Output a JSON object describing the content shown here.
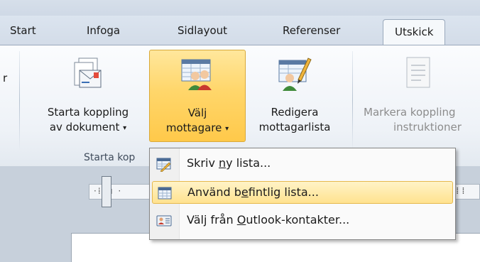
{
  "tabs": [
    {
      "label": "Start"
    },
    {
      "label": "Infoga"
    },
    {
      "label": "Sidlayout"
    },
    {
      "label": "Referenser"
    },
    {
      "label": "Utskick"
    }
  ],
  "ribbon": {
    "cutoff_left_label": "r",
    "buttons": [
      {
        "line1": "Starta koppling",
        "line2": "av dokument",
        "icon": "start-merge-icon"
      },
      {
        "line1": "Välj",
        "line2": "mottagare",
        "icon": "select-recipients-icon"
      },
      {
        "line1": "Redigera",
        "line2": "mottagarlista",
        "icon": "edit-recipient-list-icon"
      },
      {
        "line1": "Markera koppling",
        "line2": "instruktioner",
        "icon": "highlight-merge-fields-icon"
      }
    ],
    "group_label": "Starta kop"
  },
  "menu": {
    "items": [
      {
        "pre": "Skriv ",
        "key": "n",
        "post": "y lista...",
        "icon": "type-new-list-icon"
      },
      {
        "pre": "Använd b",
        "key": "e",
        "post": "fintlig lista...",
        "icon": "existing-list-icon"
      },
      {
        "pre": "Välj från ",
        "key": "O",
        "post": "utlook-kontakter...",
        "icon": "outlook-contacts-icon"
      }
    ]
  },
  "colors": {
    "selected_button": "#ffd66a",
    "menu_hover": "#ffe28f"
  }
}
